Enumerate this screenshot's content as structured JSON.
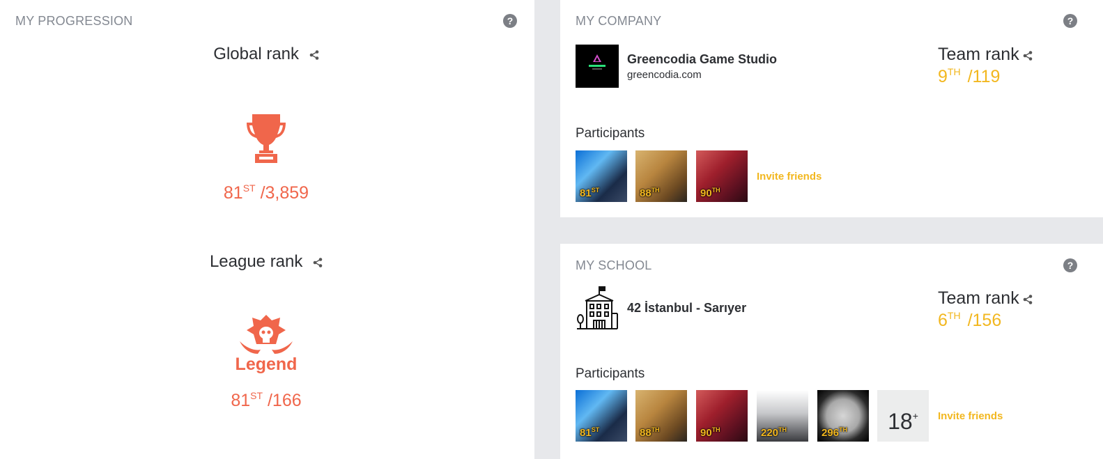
{
  "progression": {
    "title": "MY PROGRESSION",
    "help": "?",
    "global": {
      "heading": "Global rank",
      "rank": "81",
      "suffix": "ST",
      "total": "/3,859"
    },
    "league": {
      "heading": "League rank",
      "name": "Legend",
      "rank": "81",
      "suffix": "ST",
      "total": "/166"
    }
  },
  "company": {
    "title": "MY COMPANY",
    "help": "?",
    "name": "Greencodia Game Studio",
    "url": "greencodia.com",
    "logo_text": "GREENCODIA",
    "team_rank_label": "Team rank",
    "rank": "9",
    "suffix": "TH",
    "total": "/119",
    "participants_label": "Participants",
    "participants": [
      {
        "rank": "81",
        "suffix": "ST"
      },
      {
        "rank": "88",
        "suffix": "TH"
      },
      {
        "rank": "90",
        "suffix": "TH"
      }
    ],
    "invite": "Invite friends"
  },
  "school": {
    "title": "MY SCHOOL",
    "help": "?",
    "name": "42 İstanbul - Sarıyer",
    "team_rank_label": "Team rank",
    "rank": "6",
    "suffix": "TH",
    "total": "/156",
    "participants_label": "Participants",
    "participants": [
      {
        "rank": "81",
        "suffix": "ST"
      },
      {
        "rank": "88",
        "suffix": "TH"
      },
      {
        "rank": "90",
        "suffix": "TH"
      },
      {
        "rank": "220",
        "suffix": "TH"
      },
      {
        "rank": "296",
        "suffix": "TH"
      }
    ],
    "more_count": "18",
    "more_suffix": "+",
    "invite": "Invite friends"
  },
  "colors": {
    "accent_orange": "#f0664b",
    "accent_yellow": "#f2b71f",
    "background": "#e7e8eb"
  }
}
